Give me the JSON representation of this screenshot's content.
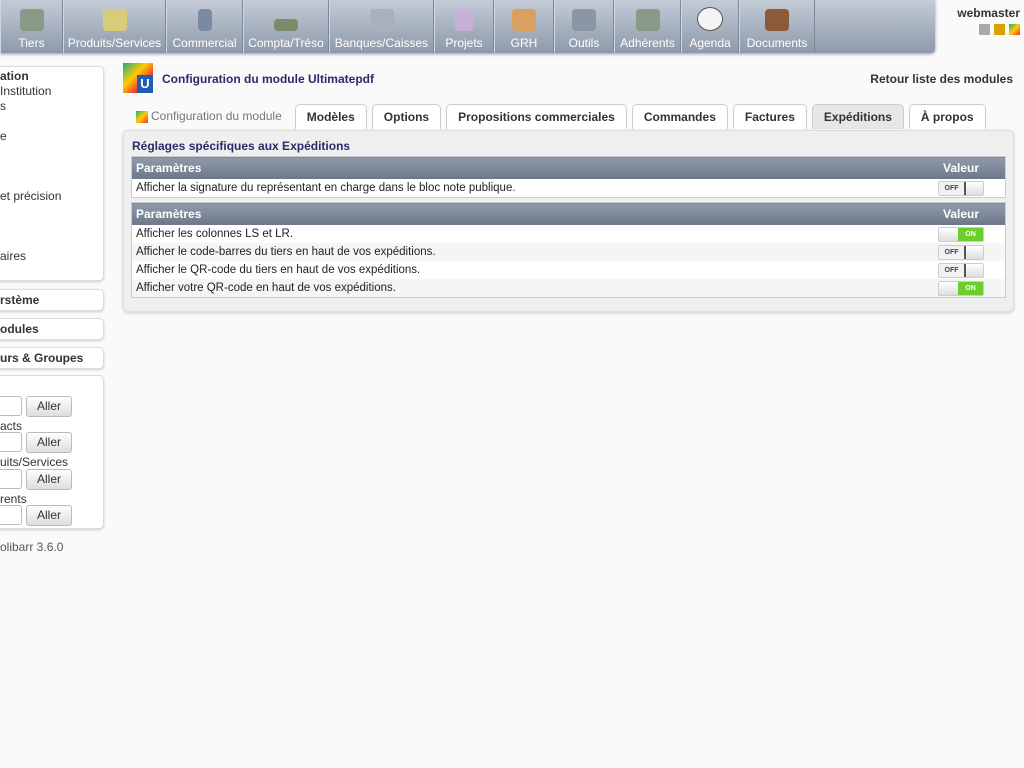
{
  "menu": [
    {
      "label": "Tiers",
      "icon": "users-icon"
    },
    {
      "label": "Produits/Services",
      "icon": "product-icon"
    },
    {
      "label": "Commercial",
      "icon": "commercial-icon"
    },
    {
      "label": "Compta/Tréso",
      "icon": "money-icon"
    },
    {
      "label": "Banques/Caisses",
      "icon": "bank-icon"
    },
    {
      "label": "Projets",
      "icon": "project-icon"
    },
    {
      "label": "GRH",
      "icon": "hr-icon"
    },
    {
      "label": "Outils",
      "icon": "tools-icon"
    },
    {
      "label": "Adhérents",
      "icon": "members-icon"
    },
    {
      "label": "Agenda",
      "icon": "clock-icon"
    },
    {
      "label": "Documents",
      "icon": "folder-icon"
    }
  ],
  "user": {
    "name": "webmaster"
  },
  "sidebar": {
    "setup_items": [
      "ation",
      "Institution",
      "s",
      "e",
      "et précision",
      "aires"
    ],
    "sections": [
      "rstème",
      "odules",
      "urs & Groupes"
    ],
    "search": {
      "labels": [
        "acts",
        "uits/Services",
        "rents"
      ],
      "button": "Aller"
    },
    "version": "olibarr 3.6.0"
  },
  "page": {
    "title": "Configuration du module Ultimatepdf",
    "back_link": "Retour liste des modules"
  },
  "tabs": [
    "Configuration du module",
    "Modèles",
    "Options",
    "Propositions commerciales",
    "Commandes",
    "Factures",
    "Expéditions",
    "À propos"
  ],
  "panel": {
    "title": "Réglages spécifiques aux Expéditions",
    "table1": {
      "col_param": "Paramètres",
      "col_value": "Valeur",
      "rows": [
        {
          "label": "Afficher la signature du représentant en charge dans le bloc note publique.",
          "value": "OFF"
        }
      ]
    },
    "table2": {
      "col_param": "Paramètres",
      "col_value": "Valeur",
      "rows": [
        {
          "label": "Afficher les colonnes LS et LR.",
          "value": "ON"
        },
        {
          "label": "Afficher le code-barres du tiers en haut de vos expéditions.",
          "value": "OFF"
        },
        {
          "label": "Afficher le QR-code du tiers en haut de vos expéditions.",
          "value": "OFF"
        },
        {
          "label": "Afficher votre QR-code en haut de vos expéditions.",
          "value": "ON"
        }
      ]
    }
  },
  "colors": {
    "on": "#6ccd2c",
    "header": "#7a8598",
    "title": "#2a2a6a"
  }
}
